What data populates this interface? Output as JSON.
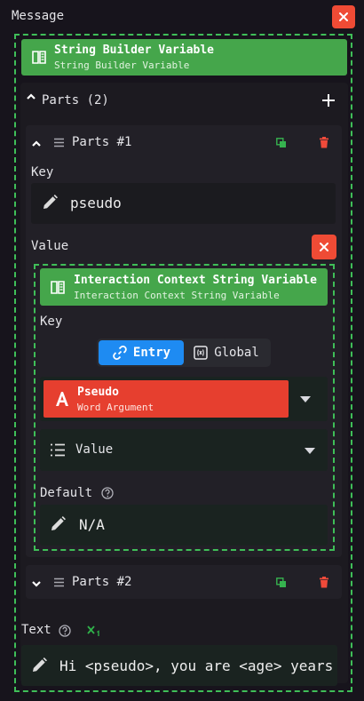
{
  "title": "Message",
  "root_variable": {
    "title": "String Builder Variable",
    "subtitle": "String Builder Variable"
  },
  "parts_header": "Parts (2)",
  "part1": {
    "label": "Parts #1",
    "key_label": "Key",
    "key_value": "pseudo",
    "value_label": "Value",
    "inner_variable": {
      "title": "Interaction Context String Variable",
      "subtitle": "Interaction Context String Variable"
    },
    "inner_key_label": "Key",
    "toggle": {
      "entry": "Entry",
      "global": "Global",
      "selected": "entry"
    },
    "argument": {
      "title": "Pseudo",
      "subtitle": "Word Argument"
    },
    "select_value": "Value",
    "default_label": "Default",
    "default_value": "N/A"
  },
  "part2": {
    "label": "Parts #2"
  },
  "text_label": "Text",
  "text_value": "Hi <pseudo>, you are <age> years old",
  "colors": {
    "accent_green": "#45a64b",
    "danger": "#ef4b35",
    "selected_blue": "#1e8bf2",
    "background": "#17141c"
  }
}
